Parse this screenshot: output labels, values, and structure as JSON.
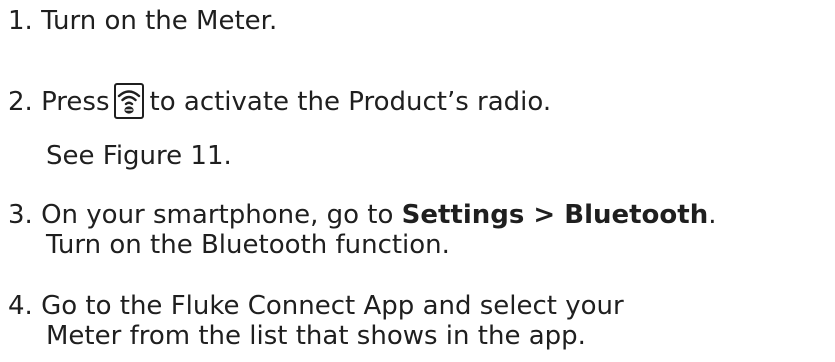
{
  "steps": [
    {
      "number": "1.",
      "text": "Turn on the Meter."
    },
    {
      "number": "2.",
      "text_before_icon": "Press",
      "icon": "wireless-radio-button-icon",
      "text_after_icon": "to activate the Product’s radio.",
      "note": "See Figure 11."
    },
    {
      "number": "3.",
      "text_before": "On your smartphone, go to",
      "bold": "Settings > Bluetooth",
      "text_after": ".",
      "line2": "Turn on the Bluetooth function."
    },
    {
      "number": "4.",
      "line1": "Go to the Fluke Connect App and select your",
      "line2": "Meter from the list that shows in the app."
    }
  ]
}
